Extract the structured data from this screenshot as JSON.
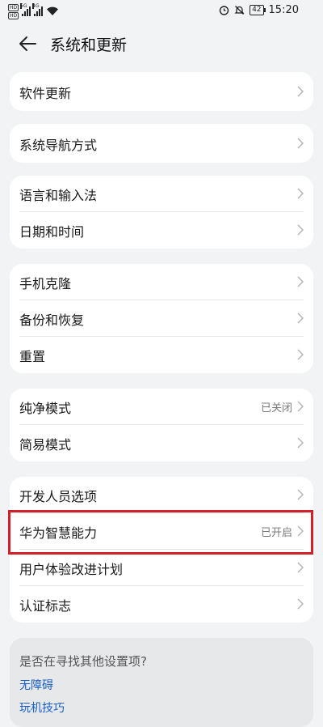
{
  "status_bar": {
    "sim1": "HD",
    "sim2": "HD",
    "net1": "5G",
    "net2": "4G",
    "battery": "42",
    "time": "15:20"
  },
  "header": {
    "title": "系统和更新"
  },
  "groups": [
    {
      "items": [
        {
          "label": "软件更新"
        }
      ]
    },
    {
      "items": [
        {
          "label": "系统导航方式"
        }
      ]
    },
    {
      "items": [
        {
          "label": "语言和输入法"
        },
        {
          "label": "日期和时间"
        }
      ]
    },
    {
      "items": [
        {
          "label": "手机克隆"
        },
        {
          "label": "备份和恢复"
        },
        {
          "label": "重置"
        }
      ]
    },
    {
      "items": [
        {
          "label": "纯净模式",
          "value": "已关闭"
        },
        {
          "label": "简易模式"
        }
      ]
    },
    {
      "items": [
        {
          "label": "开发人员选项"
        },
        {
          "label": "华为智慧能力",
          "value": "已开启"
        },
        {
          "label": "用户体验改进计划"
        },
        {
          "label": "认证标志"
        }
      ]
    }
  ],
  "help": {
    "title": "是否在寻找其他设置项?",
    "links": [
      "无障碍",
      "玩机技巧"
    ]
  },
  "colors": {
    "background": "#f1f3f5",
    "card": "#ffffff",
    "highlight": "#d0202a",
    "link": "#1a5fc9"
  }
}
